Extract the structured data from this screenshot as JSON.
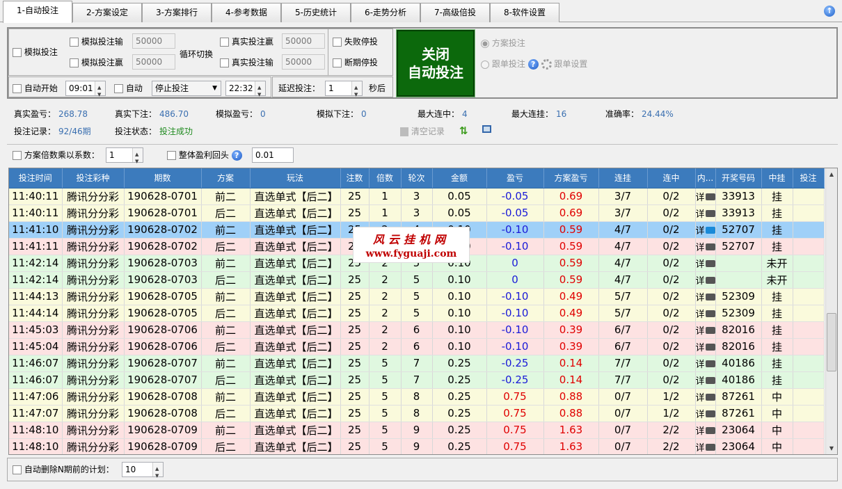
{
  "tabs": [
    "1-自动投注",
    "2-方案设定",
    "3-方案排行",
    "4-参考数据",
    "5-历史统计",
    "6-走势分析",
    "7-高级倍投",
    "8-软件设置"
  ],
  "controls": {
    "sim_bet": "模拟投注",
    "sim_lose": "模拟投注输",
    "sim_lose_val": "50000",
    "sim_win": "模拟投注赢",
    "sim_win_val": "50000",
    "cycle_switch": "循环切换",
    "real_win": "真实投注赢",
    "real_win_val": "50000",
    "real_lose": "真实投注输",
    "real_lose_val": "50000",
    "fail_stop": "失败停投",
    "break_stop": "断期停投",
    "auto_start": "自动开始",
    "auto_start_time": "09:01",
    "auto": "自动",
    "stop_select": "停止投注",
    "stop_time": "22:32",
    "delay": "延迟投注：",
    "delay_val": "1",
    "seconds": "秒后",
    "main_button_line1": "关闭",
    "main_button_line2": "自动投注",
    "plan_bet": "方案投注",
    "follow_bet": "跟单投注",
    "follow_settings": "跟单设置"
  },
  "stats": {
    "real_profit_label": "真实盈亏：",
    "real_profit": "268.78",
    "real_bet_label": "真实下注：",
    "real_bet": "486.70",
    "sim_profit_label": "模拟盈亏：",
    "sim_profit": "0",
    "sim_bet_label": "模拟下注：",
    "sim_bet": "0",
    "max_hit_label": "最大连中：",
    "max_hit": "4",
    "max_miss_label": "最大连挂：",
    "max_miss": "16",
    "accuracy_label": "准确率：",
    "accuracy": "24.44%",
    "record_label": "投注记录：",
    "record": "92/46期",
    "status_label": "投注状态：",
    "status": "投注成功",
    "clear": "清空记录"
  },
  "multiplier": {
    "label": "方案倍数乘以系数：",
    "value": "1",
    "rollback": "整体盈利回头",
    "rollback_value": "0.01"
  },
  "table": {
    "headers": [
      "投注时间",
      "投注彩种",
      "期数",
      "方案",
      "玩法",
      "注数",
      "倍数",
      "轮次",
      "金额",
      "盈亏",
      "方案盈亏",
      "连挂",
      "连中",
      "内...",
      "开奖号码",
      "中挂",
      "投注"
    ],
    "rows": [
      {
        "c": [
          "11:40:11",
          "腾讯分分彩",
          "190628-0701",
          "前二",
          "直选单式【后二】",
          "25",
          "1",
          "3",
          "0.05",
          "-0.05",
          "0.69",
          "3/7",
          "0/2",
          "详",
          "33913",
          "挂",
          ""
        ],
        "color": "yellow",
        "pl": "neg"
      },
      {
        "c": [
          "11:40:11",
          "腾讯分分彩",
          "190628-0701",
          "后二",
          "直选单式【后二】",
          "25",
          "1",
          "3",
          "0.05",
          "-0.05",
          "0.69",
          "3/7",
          "0/2",
          "详",
          "33913",
          "挂",
          ""
        ],
        "color": "yellow",
        "pl": "neg"
      },
      {
        "c": [
          "11:41:10",
          "腾讯分分彩",
          "190628-0702",
          "前二",
          "直选单式【后二】",
          "25",
          "2",
          "4",
          "0.10",
          "-0.10",
          "0.59",
          "4/7",
          "0/2",
          "详",
          "52707",
          "挂",
          ""
        ],
        "color": "sel",
        "pl": "neg"
      },
      {
        "c": [
          "11:41:11",
          "腾讯分分彩",
          "190628-0702",
          "后二",
          "直选单式【后二】",
          "25",
          "2",
          "4",
          "0.10",
          "-0.10",
          "0.59",
          "4/7",
          "0/2",
          "详",
          "52707",
          "挂",
          ""
        ],
        "color": "pink",
        "pl": "neg"
      },
      {
        "c": [
          "11:42:14",
          "腾讯分分彩",
          "190628-0703",
          "前二",
          "直选单式【后二】",
          "25",
          "2",
          "5",
          "0.10",
          "0",
          "0.59",
          "4/7",
          "0/2",
          "详",
          "",
          "未开",
          ""
        ],
        "color": "green",
        "pl": "neg"
      },
      {
        "c": [
          "11:42:14",
          "腾讯分分彩",
          "190628-0703",
          "后二",
          "直选单式【后二】",
          "25",
          "2",
          "5",
          "0.10",
          "0",
          "0.59",
          "4/7",
          "0/2",
          "详",
          "",
          "未开",
          ""
        ],
        "color": "green",
        "pl": "neg"
      },
      {
        "c": [
          "11:44:13",
          "腾讯分分彩",
          "190628-0705",
          "前二",
          "直选单式【后二】",
          "25",
          "2",
          "5",
          "0.10",
          "-0.10",
          "0.49",
          "5/7",
          "0/2",
          "详",
          "52309",
          "挂",
          ""
        ],
        "color": "yellow",
        "pl": "neg"
      },
      {
        "c": [
          "11:44:14",
          "腾讯分分彩",
          "190628-0705",
          "后二",
          "直选单式【后二】",
          "25",
          "2",
          "5",
          "0.10",
          "-0.10",
          "0.49",
          "5/7",
          "0/2",
          "详",
          "52309",
          "挂",
          ""
        ],
        "color": "yellow",
        "pl": "neg"
      },
      {
        "c": [
          "11:45:03",
          "腾讯分分彩",
          "190628-0706",
          "前二",
          "直选单式【后二】",
          "25",
          "2",
          "6",
          "0.10",
          "-0.10",
          "0.39",
          "6/7",
          "0/2",
          "详",
          "82016",
          "挂",
          ""
        ],
        "color": "pink",
        "pl": "neg"
      },
      {
        "c": [
          "11:45:04",
          "腾讯分分彩",
          "190628-0706",
          "后二",
          "直选单式【后二】",
          "25",
          "2",
          "6",
          "0.10",
          "-0.10",
          "0.39",
          "6/7",
          "0/2",
          "详",
          "82016",
          "挂",
          ""
        ],
        "color": "pink",
        "pl": "neg"
      },
      {
        "c": [
          "11:46:07",
          "腾讯分分彩",
          "190628-0707",
          "前二",
          "直选单式【后二】",
          "25",
          "5",
          "7",
          "0.25",
          "-0.25",
          "0.14",
          "7/7",
          "0/2",
          "详",
          "40186",
          "挂",
          ""
        ],
        "color": "green",
        "pl": "neg"
      },
      {
        "c": [
          "11:46:07",
          "腾讯分分彩",
          "190628-0707",
          "后二",
          "直选单式【后二】",
          "25",
          "5",
          "7",
          "0.25",
          "-0.25",
          "0.14",
          "7/7",
          "0/2",
          "详",
          "40186",
          "挂",
          ""
        ],
        "color": "green",
        "pl": "neg"
      },
      {
        "c": [
          "11:47:06",
          "腾讯分分彩",
          "190628-0708",
          "前二",
          "直选单式【后二】",
          "25",
          "5",
          "8",
          "0.25",
          "0.75",
          "0.88",
          "0/7",
          "1/2",
          "详",
          "87261",
          "中",
          ""
        ],
        "color": "yellow",
        "pl": "pos"
      },
      {
        "c": [
          "11:47:07",
          "腾讯分分彩",
          "190628-0708",
          "后二",
          "直选单式【后二】",
          "25",
          "5",
          "8",
          "0.25",
          "0.75",
          "0.88",
          "0/7",
          "1/2",
          "详",
          "87261",
          "中",
          ""
        ],
        "color": "yellow",
        "pl": "pos"
      },
      {
        "c": [
          "11:48:10",
          "腾讯分分彩",
          "190628-0709",
          "前二",
          "直选单式【后二】",
          "25",
          "5",
          "9",
          "0.25",
          "0.75",
          "1.63",
          "0/7",
          "2/2",
          "详",
          "23064",
          "中",
          ""
        ],
        "color": "pink",
        "pl": "pos"
      },
      {
        "c": [
          "11:48:10",
          "腾讯分分彩",
          "190628-0709",
          "后二",
          "直选单式【后二】",
          "25",
          "5",
          "9",
          "0.25",
          "0.75",
          "1.63",
          "0/7",
          "2/2",
          "详",
          "23064",
          "中",
          ""
        ],
        "color": "pink",
        "pl": "pos"
      }
    ]
  },
  "watermark": {
    "line1": "风云挂机网",
    "line2": "www.fyguaji.com"
  },
  "bottom": {
    "label": "自动删除N期前的计划：",
    "value": "10"
  }
}
